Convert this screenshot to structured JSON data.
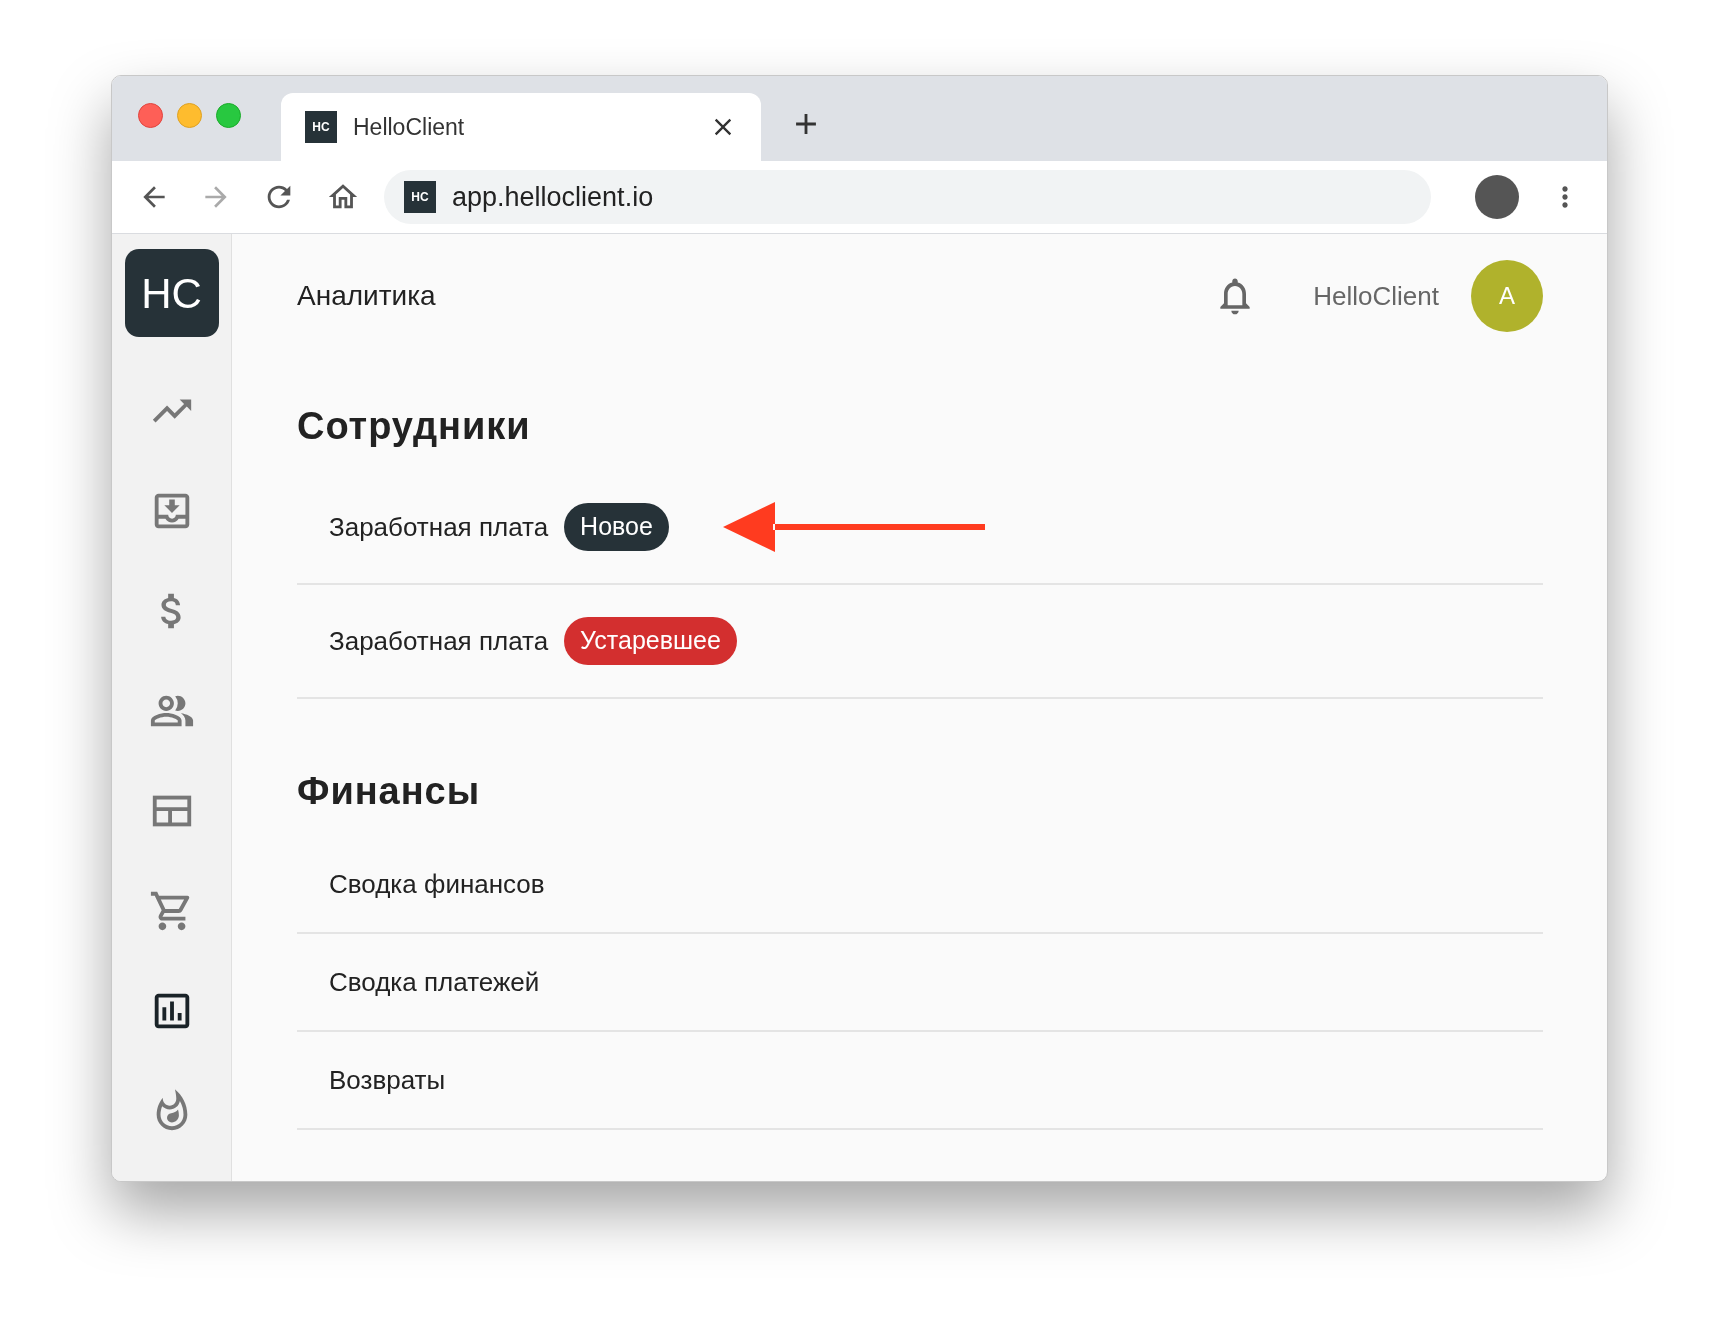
{
  "browser": {
    "tab": {
      "favicon": "HC",
      "title": "HelloClient"
    },
    "address": {
      "favicon": "HC",
      "url": "app.helloclient.io"
    }
  },
  "sidebar": {
    "logo": "HC",
    "items": [
      {
        "selected": false
      },
      {
        "selected": false
      },
      {
        "selected": false
      },
      {
        "selected": false
      },
      {
        "selected": false
      },
      {
        "selected": false
      },
      {
        "selected": true
      },
      {
        "selected": false
      }
    ]
  },
  "header": {
    "title": "Аналитика",
    "user": "HelloClient",
    "avatar": "A"
  },
  "sections": [
    {
      "title": "Сотрудники",
      "items": [
        {
          "label": "Заработная плата",
          "badge": {
            "text": "Новое",
            "kind": "new"
          },
          "annotated": true
        },
        {
          "label": "Заработная плата",
          "badge": {
            "text": "Устаревшее",
            "kind": "outdated"
          },
          "annotated": false
        }
      ]
    },
    {
      "title": "Финансы",
      "items": [
        {
          "label": "Сводка финансов",
          "annotated": false
        },
        {
          "label": "Сводка платежей",
          "annotated": false
        },
        {
          "label": "Возвраты",
          "annotated": false
        }
      ]
    }
  ]
}
